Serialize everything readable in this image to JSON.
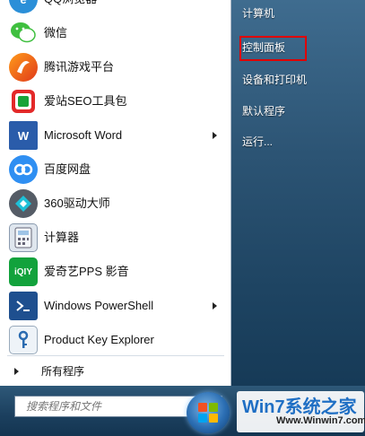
{
  "left_list": {
    "items": [
      {
        "label": "QQ浏览器",
        "icon": "qq-browser-icon",
        "submenu": false
      },
      {
        "label": "微信",
        "icon": "wechat-icon",
        "submenu": false
      },
      {
        "label": "腾讯游戏平台",
        "icon": "tencent-games-icon",
        "submenu": false
      },
      {
        "label": "爱站SEO工具包",
        "icon": "aizhan-seo-icon",
        "submenu": false
      },
      {
        "label": "Microsoft Word",
        "icon": "word-icon",
        "submenu": true
      },
      {
        "label": "百度网盘",
        "icon": "baidu-netdisk-icon",
        "submenu": false
      },
      {
        "label": "360驱动大师",
        "icon": "driver-master-icon",
        "submenu": false
      },
      {
        "label": "计算器",
        "icon": "calculator-icon",
        "submenu": false
      },
      {
        "label": "爱奇艺PPS 影音",
        "icon": "iqiyi-icon",
        "submenu": false
      },
      {
        "label": "Windows PowerShell",
        "icon": "powershell-icon",
        "submenu": true
      },
      {
        "label": "Product Key Explorer",
        "icon": "key-explorer-icon",
        "submenu": false
      }
    ],
    "all_programs": "所有程序"
  },
  "search": {
    "placeholder": "搜索程序和文件"
  },
  "right_list": {
    "items": [
      {
        "label": "计算机"
      },
      {
        "label": "控制面板",
        "highlighted": true
      },
      {
        "label": "设备和打印机"
      },
      {
        "label": "默认程序"
      },
      {
        "label": "运行..."
      }
    ]
  },
  "watermark": {
    "title": "Win7系统之家",
    "site": "Www.Winwin7.com"
  },
  "colors": {
    "highlight": "#e00000",
    "accent": "#1f6fc4"
  }
}
